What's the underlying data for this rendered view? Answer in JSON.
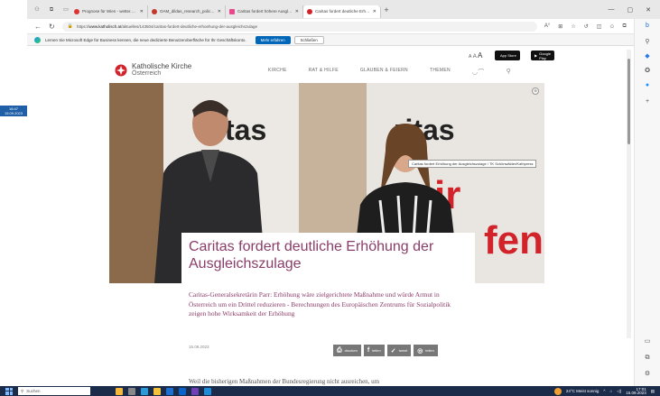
{
  "desktop": {
    "clock_time": "16:47",
    "clock_date": "15.09.2023"
  },
  "tabs": [
    {
      "title": "Prognose für Wien - wetter.ORF.at",
      "color": "#d33"
    },
    {
      "title": "OAM_dildas_research_policy-mini",
      "color": "#c0392b"
    },
    {
      "title": "Caritas fordert höhere Ausgleichszulage",
      "color": "#e64a8c"
    },
    {
      "title": "Caritas fordert deutliche Erhöhung",
      "color": "#d2232a"
    }
  ],
  "address": {
    "url_prefix": "https://",
    "url_domain": "www.katholisch.at",
    "url_path": "/aktuelles/143504/caritas-fordert-deutliche-erhoehung-der-ausgleichszulage"
  },
  "notice": {
    "text": "Lernen Sie Microsoft Edge für Business kennen, die neue dedizierte Benutzeroberfläche für Ihr Geschäftskonto.",
    "primary": "Mehr erfahren",
    "secondary": "Schließen"
  },
  "site": {
    "logo_line1": "Katholische Kirche",
    "logo_line2": "Österreich",
    "menu": [
      "KIRCHE",
      "RAT & HILFE",
      "GLAUBEN & FEIERN",
      "THEMEN"
    ],
    "text_size_small": "A",
    "text_size_med": "A",
    "text_size_large": "A",
    "app_store": "App Store",
    "google_play": "Google Play"
  },
  "hero": {
    "caption_tooltip": "Caritas fordert Erhöhung der Ausgleichszulage / TK Schönwälder/Kathpress",
    "board_text_left": "tas",
    "board_text_right": "ritas",
    "red_text": "fen",
    "red_text_right": "ir"
  },
  "article": {
    "headline": "Caritas fordert deutliche Erhöhung der Ausgleichszulage",
    "lead": "Caritas-Generalsekretärin Parr: Erhöhung wäre zielgerichtete Maßnahme und würde Armut in Österreich um ein Drittel reduzieren - Berechnungen des Europäischen Zentrums für Sozialpolitik zeigen hohe Wirksamkeit der Erhöhung",
    "date": "15.09.2023",
    "share": [
      "drucken",
      "teilen",
      "tweet",
      "teilen"
    ],
    "body_start": "Weil die bisherigen Maßnahmen der Bundesregierung nicht ausreichen, um"
  },
  "taskbar": {
    "search_placeholder": "Suchen",
    "weather": "24°C  Meist sonnig",
    "time": "17:01",
    "date": "15.09.2023"
  }
}
